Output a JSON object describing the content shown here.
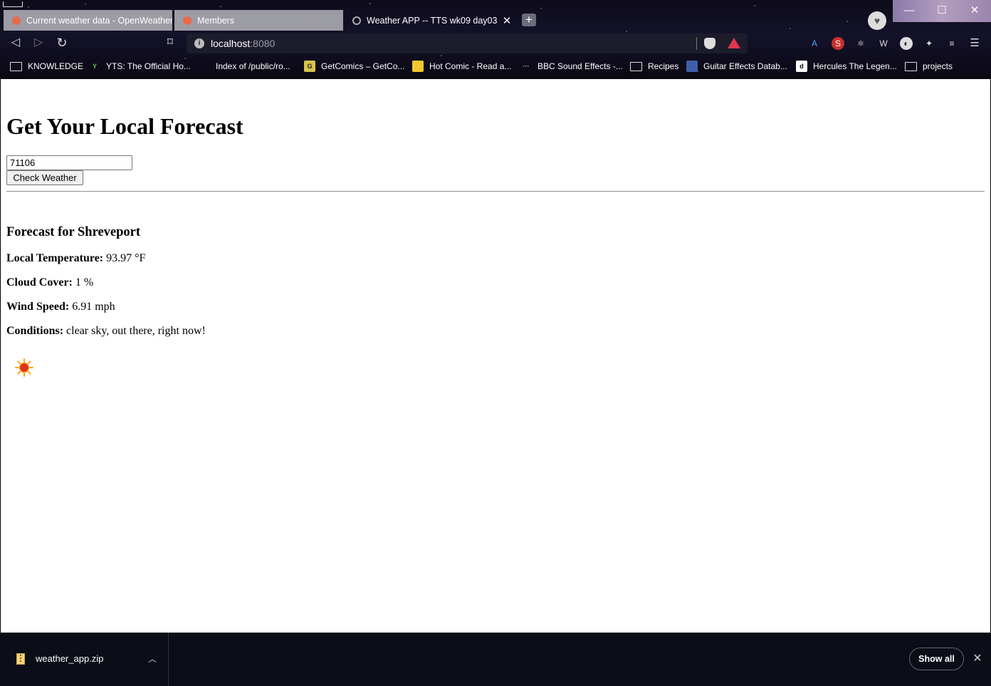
{
  "browser": {
    "tabs": [
      {
        "title": "Current weather data - OpenWeather",
        "active": false
      },
      {
        "title": "Members",
        "active": false
      },
      {
        "title": "Weather APP -- TTS wk09 day03",
        "active": true
      }
    ],
    "new_tab_icon": "plus-icon",
    "url_host": "localhost",
    "url_port": ":8080",
    "bookmarks": [
      {
        "label": "KNOWLEDGE",
        "icon": "folder-icon"
      },
      {
        "label": "YTS: The Official Ho...",
        "icon": "yts-icon"
      },
      {
        "label": "Index of /public/ro...",
        "icon": "blank-icon"
      },
      {
        "label": "GetComics – GetCo...",
        "icon": "getcomics-icon"
      },
      {
        "label": "Hot Comic - Read a...",
        "icon": "hotcomic-icon"
      },
      {
        "label": "BBC Sound Effects -...",
        "icon": "bbc-icon"
      },
      {
        "label": "Recipes",
        "icon": "folder-icon"
      },
      {
        "label": "Guitar Effects Datab...",
        "icon": "guitar-icon"
      },
      {
        "label": "Hercules The Legen...",
        "icon": "dailymotion-icon"
      },
      {
        "label": "projects",
        "icon": "folder-icon"
      }
    ]
  },
  "page": {
    "title": "Get Your Local Forecast",
    "zip_value": "71106",
    "button_label": "Check Weather",
    "forecast_heading": "Forecast for Shreveport",
    "rows": [
      {
        "label": "Local Temperature:",
        "value": "93.97 °F"
      },
      {
        "label": "Cloud Cover:",
        "value": "1 %"
      },
      {
        "label": "Wind Speed:",
        "value": "6.91 mph"
      },
      {
        "label": "Conditions:",
        "value": "clear sky, out there, right now!"
      }
    ],
    "weather_icon": "sun-icon"
  },
  "downloads": {
    "file_name": "weather_app.zip",
    "show_all_label": "Show all"
  }
}
